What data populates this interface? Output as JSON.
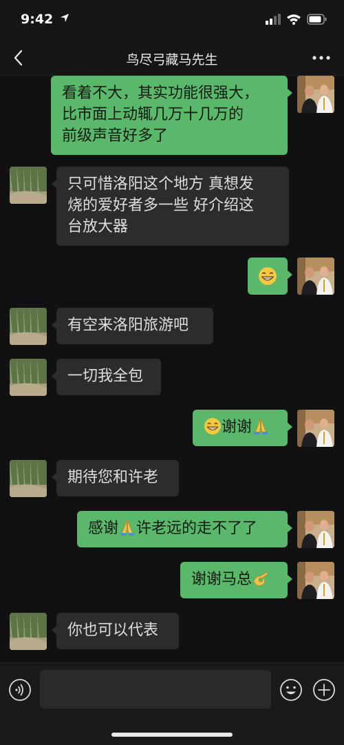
{
  "status_bar": {
    "time": "9:42"
  },
  "header": {
    "title": "鸟尽弓藏马先生"
  },
  "messages": [
    {
      "side": "right",
      "lines": [
        "看着不大，其实功能很强大，",
        "比市面上动辄几万十几万的",
        "前级声音好多了"
      ]
    },
    {
      "side": "left",
      "lines": [
        "只可惜洛阳这个地方  真想发",
        "烧的爱好者多一些  好介绍这",
        "台放大器"
      ]
    },
    {
      "side": "right",
      "lines": [
        ""
      ],
      "emoji_only": "grin-emoji"
    },
    {
      "side": "left",
      "lines": [
        "有空来洛阳旅游吧"
      ]
    },
    {
      "side": "left",
      "lines": [
        "一切我全包"
      ]
    },
    {
      "side": "right",
      "text": "谢谢",
      "lead_emoji": "grin-emoji",
      "trail_emoji": "pray-emoji"
    },
    {
      "side": "left",
      "lines": [
        "期待您和许老"
      ]
    },
    {
      "side": "right",
      "text_a": "感谢",
      "mid_emoji": "pray-emoji",
      "text_b": "许老远的走不了了"
    },
    {
      "side": "right",
      "text": "谢谢马总",
      "trail_emoji": "ok-hand-emoji"
    },
    {
      "side": "left",
      "lines": [
        "你也可以代表"
      ]
    }
  ],
  "input": {
    "placeholder": ""
  },
  "colors": {
    "bubble_self": "#59b869",
    "bubble_other": "#2c2c2c",
    "background": "#111111"
  }
}
